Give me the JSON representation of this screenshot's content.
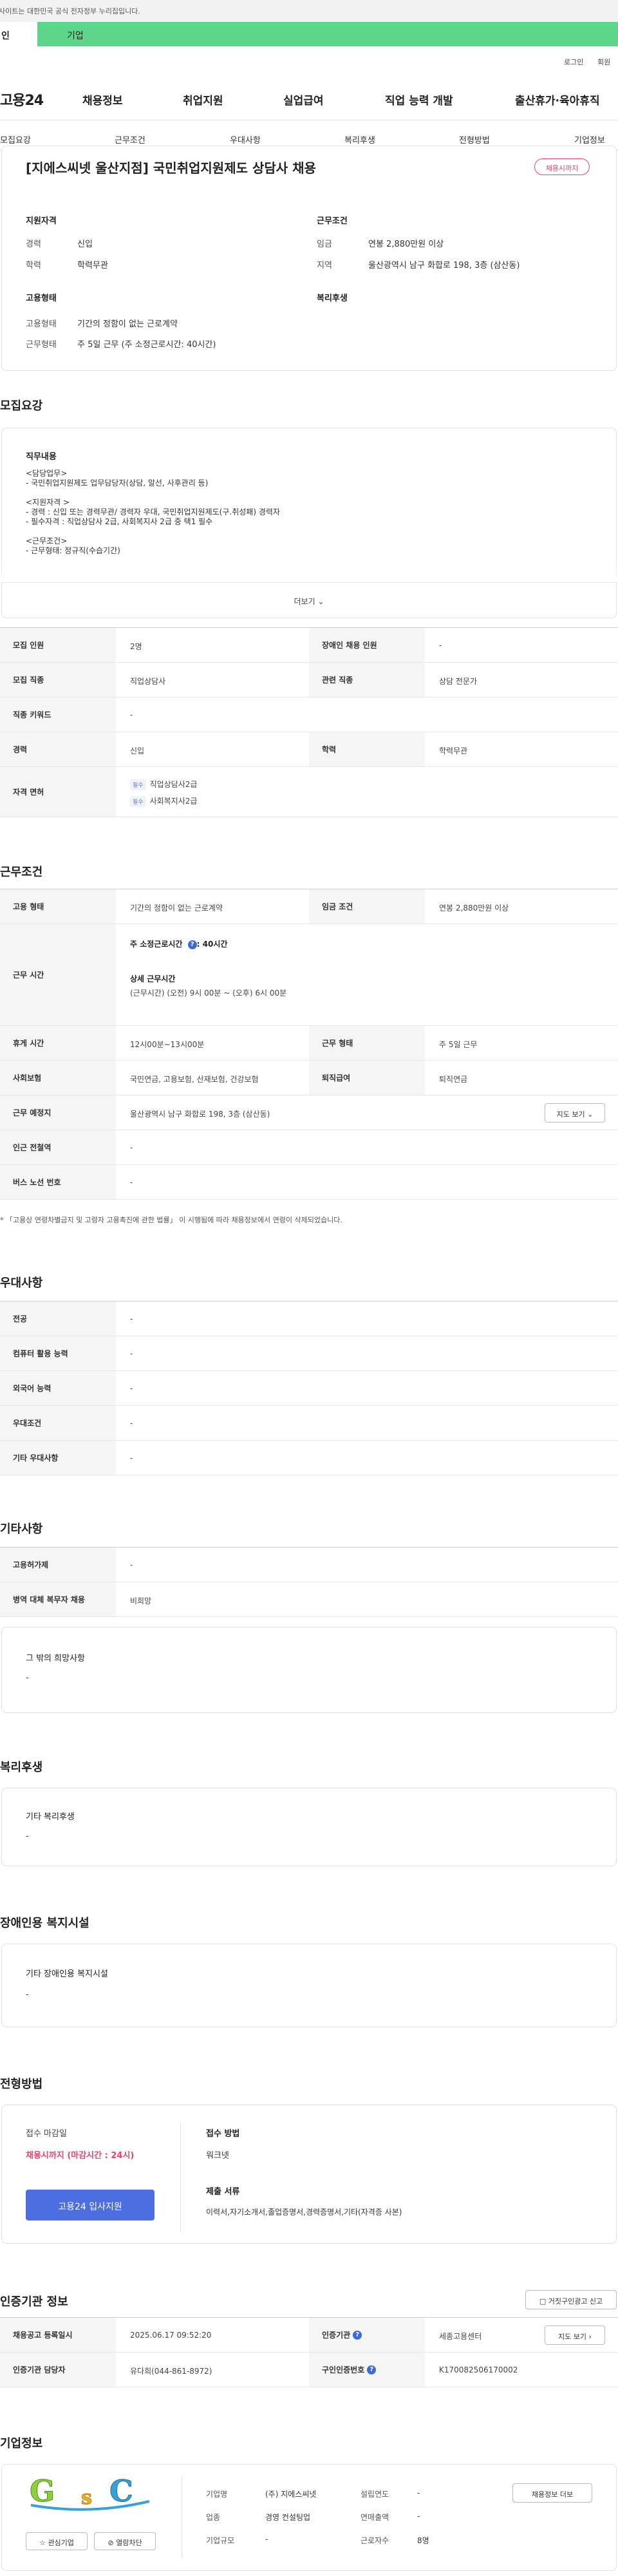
{
  "gov_bar": {
    "text": "사이트는 대한민국 공식 전자정부 누리집입니다."
  },
  "tabs": {
    "personal": "인",
    "corporate": "기업"
  },
  "util": {
    "login": "로그인",
    "join": "회원"
  },
  "logo": "고용24",
  "main_nav": [
    "채용정보",
    "취업지원",
    "실업급여",
    "직업 능력 개발",
    "출산휴가·육아휴직"
  ],
  "sub_nav": [
    "모집요강",
    "근무조건",
    "우대사항",
    "복리후생",
    "전형방법",
    "기업정보"
  ],
  "summary": {
    "title": "[지에스씨넷 울산지점] 국민취업지원제도 상담사 채용",
    "badge": "채용시까지",
    "qualification_heading": "지원자격",
    "career_label": "경력",
    "career_value": "신입",
    "education_label": "학력",
    "education_value": "학력무관",
    "conditions_heading": "근무조건",
    "wage_label": "임금",
    "wage_value": "연봉 2,880만원 이상",
    "region_label": "지역",
    "region_value": "울산광역시 남구 화합로 198, 3층 (삼산동)",
    "employment_heading": "고용형태",
    "welfare_heading": "복리후생",
    "emp_type_label": "고용형태",
    "emp_type_value": "기간의 정함이 없는 근로계약",
    "work_type_label": "근무형태",
    "work_type_value": "주 5일 근무 (주 소정근로시간: 40시간)"
  },
  "recruit": {
    "heading": "모집요강",
    "duties_heading": "직무내용",
    "desc_lines": [
      "<담당업무>",
      "- 국민취업지원제도 업무담당자(상담, 알선, 사후관리 등)",
      "",
      "<지원자격 >",
      "- 경력 : 신입 또는 경력무관/ 경력자 우대, 국민취업지원제도(구.취성패) 경력자",
      "- 필수자격 : 직업상담사 2급, 사회복지사 2급 중 택1 필수",
      "",
      "<근무조건>",
      "- 근무형태: 정규직(수습기간)"
    ],
    "more": "더보기",
    "rows": {
      "headcount_label": "모집 인원",
      "headcount_value": "2명",
      "disabled_label": "장애인 채용 인원",
      "disabled_value": "-",
      "job_label": "모집 직종",
      "job_value": "직업상담사",
      "related_label": "관련 직종",
      "related_value": "상담 전문가",
      "keyword_label": "직종 키워드",
      "keyword_value": "-",
      "career_label": "경력",
      "career_value": "신입",
      "edu_label": "학력",
      "edu_value": "학력무관",
      "license_label": "자격 면허",
      "pill": "필수",
      "license1": "직업상담사2급",
      "license2": "사회복지사2급"
    }
  },
  "conditions": {
    "heading": "근무조건",
    "emp_type_label": "고용 형태",
    "emp_type_value": "기간의 정함이 없는 근로계약",
    "wage_label": "임금 조건",
    "wage_value": "연봉 2,880만원 이상",
    "hours_label": "근무 시간",
    "hours_main": "주 소정근로시간 ",
    "hours_main2": ": 40시간",
    "hours_detail_title": "상세 근무시간",
    "hours_detail": "(근무시간) (오전) 9시 00분 ~ (오후) 6시 00분",
    "break_label": "휴게 시간",
    "break_value": "12시00분~13시00분",
    "worktype_label": "근무 형태",
    "worktype_value": "주 5일 근무",
    "insurance_label": "사회보험",
    "insurance_value": "국민연금, 고용보험, 산재보험, 건강보험",
    "severance_label": "퇴직급여",
    "severance_value": "퇴직연금",
    "location_label": "근무 예정지",
    "location_value": "울산광역시 남구 화합로 198, 3층 (삼산동)",
    "map_btn": "지도 보기",
    "subway_label": "인근 전철역",
    "subway_value": "-",
    "bus_label": "버스 노선 번호",
    "bus_value": "-",
    "note": "* 「고용상 연령차별금지 및 고령자 고용촉진에 관한 법률」 이 시행됨에 따라 채용정보에서 연령이 삭제되었습니다."
  },
  "preference": {
    "heading": "우대사항",
    "rows": [
      {
        "label": "전공",
        "value": "-"
      },
      {
        "label": "컴퓨터 활용 능력",
        "value": "-"
      },
      {
        "label": "외국어 능력",
        "value": "-"
      },
      {
        "label": "우대조건",
        "value": "-"
      },
      {
        "label": "기타 우대사항",
        "value": "-"
      }
    ]
  },
  "other": {
    "heading": "기타사항",
    "rows": [
      {
        "label": "고용허가제",
        "value": "-"
      },
      {
        "label": "병역 대체 복무자 채용",
        "value": "비희망"
      }
    ],
    "etc_title": "그 밖의 희망사항",
    "etc_value": "-"
  },
  "welfare": {
    "heading": "복리후생",
    "box_title": "기타 복리후생",
    "box_value": "-"
  },
  "disabled_fac": {
    "heading": "장애인용 복지시설",
    "box_title": "기타 장애인용 복지시설",
    "box_value": "-"
  },
  "selection": {
    "heading": "전형방법",
    "deadline_label": "접수 마감일",
    "deadline_value": "채용시까지 (마감시간 : 24시)",
    "apply_btn": "고용24 입사지원",
    "method_label": "접수 방법",
    "method_value": "워크넷",
    "docs_label": "제출 서류",
    "docs_value": "이력서,자기소개서,졸업증명서,경력증명서,기타(자격증 사본)"
  },
  "agency": {
    "heading": "인증기관 정보",
    "report_btn": "거짓구인광고 신고",
    "reg_date_label": "채용공고 등록일시",
    "reg_date_value": "2025.06.17 09:52:20",
    "agency_label": "인증기관",
    "agency_value": "세종고용센터",
    "map_btn": "지도 보기",
    "manager_label": "인증기관 담당자",
    "manager_value": "유다희(044-861-8972)",
    "id_label": "구인인증번호",
    "id_value": "K170082506170002"
  },
  "company": {
    "heading": "기업정보",
    "logo_letters": [
      "G",
      "s",
      "C"
    ],
    "fav_btn": "관심기업",
    "block_btn": "열람차단",
    "name_label": "기업명",
    "name_value": "(주) 지에스씨넷",
    "founded_label": "설립연도",
    "founded_value": "-",
    "jobs_btn": "채용정보 더보",
    "industry_label": "업종",
    "industry_value": "경영 컨설팅업",
    "sales_label": "연매출액",
    "sales_value": "-",
    "size_label": "기업규모",
    "size_value": "-",
    "employees_label": "근로자수",
    "employees_value": "8명"
  },
  "colors": {
    "accent_green": "#5dd68c",
    "badge_red": "#e8436f",
    "apply_blue": "#4d6ee0",
    "deadline_red": "#e8436f"
  }
}
